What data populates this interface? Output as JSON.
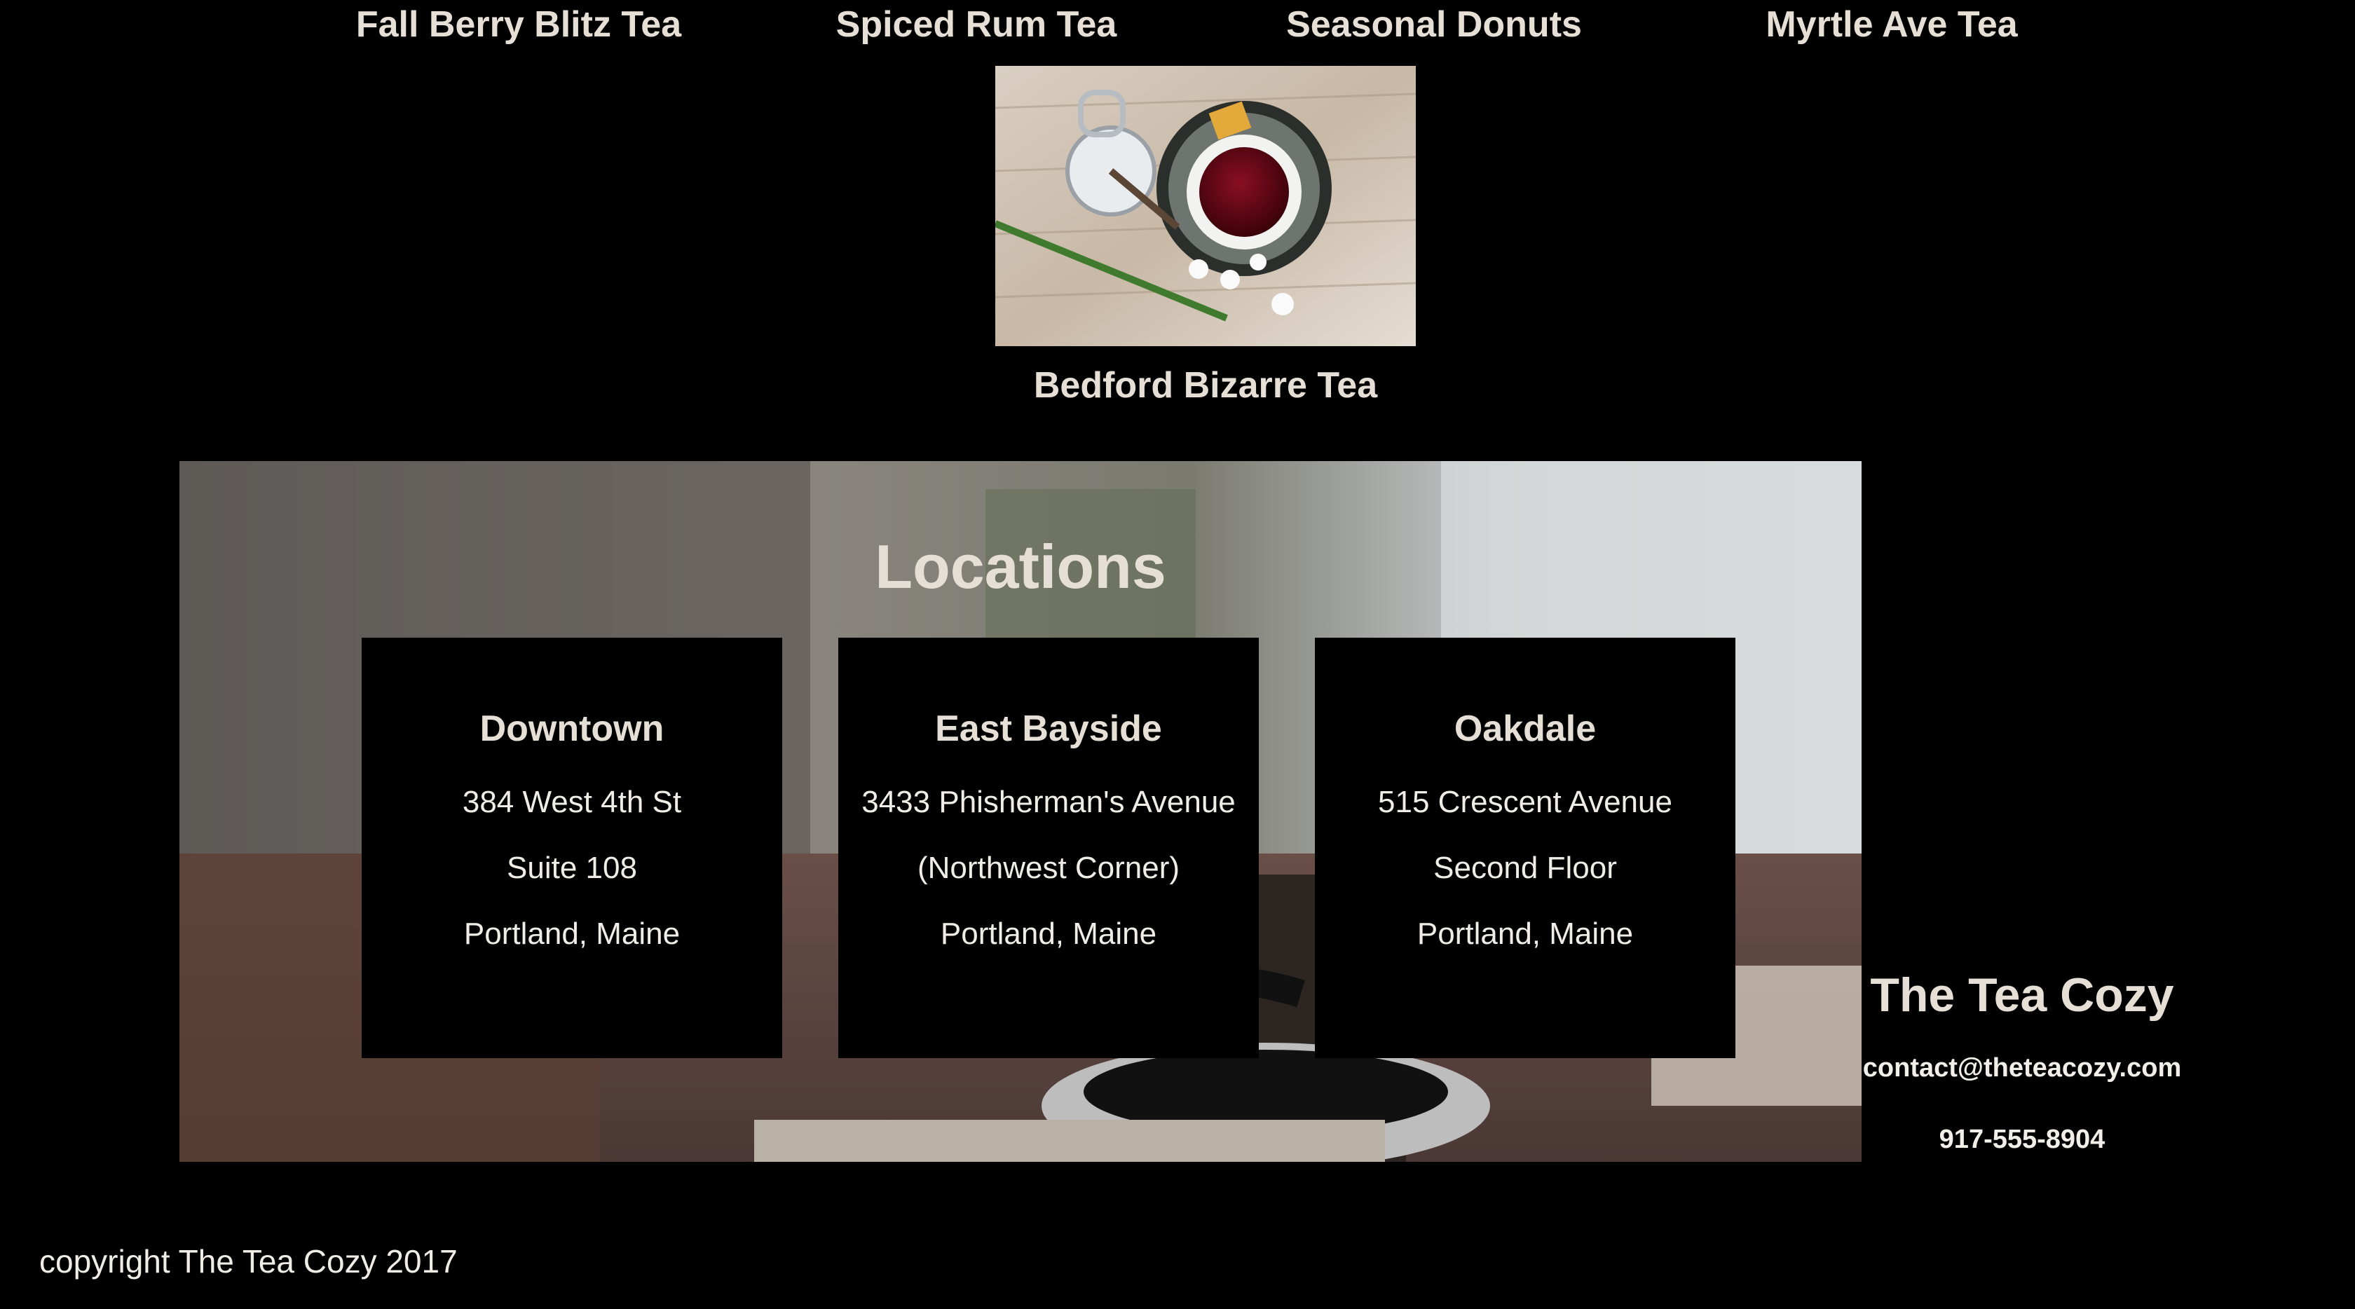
{
  "nav": {
    "items": [
      {
        "label": "Fall Berry Blitz Tea"
      },
      {
        "label": "Spiced Rum Tea"
      },
      {
        "label": "Seasonal Donuts"
      },
      {
        "label": "Myrtle Ave Tea"
      }
    ]
  },
  "featured": {
    "image_icon": "tea-cup-photo",
    "caption": "Bedford Bizarre Tea"
  },
  "locations": {
    "heading": "Locations",
    "cards": [
      {
        "name": "Downtown",
        "lines": [
          "384 West 4th St",
          "Suite 108",
          "Portland, Maine"
        ]
      },
      {
        "name": "East Bayside",
        "lines": [
          "3433 Phisherman's Avenue",
          "(Northwest Corner)",
          "Portland, Maine"
        ]
      },
      {
        "name": "Oakdale",
        "lines": [
          "515 Crescent Avenue",
          "Second Floor",
          "Portland, Maine"
        ]
      }
    ]
  },
  "contact": {
    "brand": "The Tea Cozy",
    "email": "contact@theteacozy.com",
    "phone": "917-555-8904"
  },
  "footer": {
    "copyright": "copyright The Tea Cozy 2017"
  },
  "colors": {
    "background": "#000000",
    "text": "#e6dfd6"
  }
}
